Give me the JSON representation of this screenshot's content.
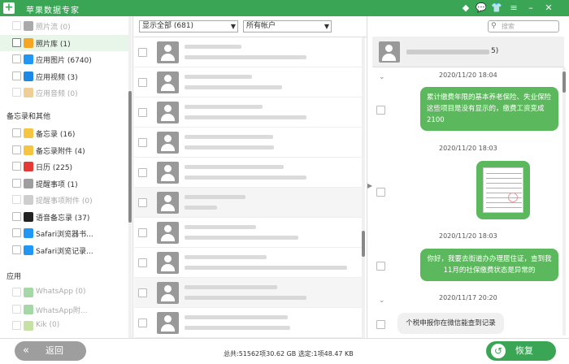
{
  "app": {
    "title": "苹果数据专家",
    "logo": "+"
  },
  "titlebar_icons": [
    "diamond-icon",
    "chat-icon",
    "skin-icon",
    "menu-icon",
    "minimize-icon",
    "close-icon"
  ],
  "sidebar": {
    "items_top": [
      {
        "label": "照片流 (0)",
        "icon": "camera-icon",
        "color": "#555",
        "disabled": true,
        "checked_style": "normal",
        "active": false
      },
      {
        "label": "照片库 (1)",
        "icon": "gallery-icon",
        "color": "#f5a623",
        "disabled": false,
        "checked_style": "green",
        "active": true
      },
      {
        "label": "应用图片 (6740)",
        "icon": "image-icon",
        "color": "#2196f3",
        "disabled": false,
        "checked_style": "normal",
        "active": false
      },
      {
        "label": "应用视频 (3)",
        "icon": "video-icon",
        "color": "#1e88e5",
        "disabled": false,
        "checked_style": "normal",
        "active": false
      },
      {
        "label": "应用音频 (0)",
        "icon": "audio-icon",
        "color": "#e0a030",
        "disabled": true,
        "checked_style": "normal",
        "active": false
      }
    ],
    "section_memo": "备忘录和其他",
    "items_memo": [
      {
        "label": "备忘录 (16)",
        "icon": "note-icon",
        "color": "#f5c542",
        "disabled": false
      },
      {
        "label": "备忘录附件 (4)",
        "icon": "note-attachment-icon",
        "color": "#f5c542",
        "disabled": false
      },
      {
        "label": "日历 (225)",
        "icon": "calendar-icon",
        "color": "#e53935",
        "disabled": false
      },
      {
        "label": "提醒事项 (1)",
        "icon": "reminder-icon",
        "color": "#9e9e9e",
        "disabled": false
      },
      {
        "label": "提醒事项附件 (0)",
        "icon": "reminder-attachment-icon",
        "color": "#9e9e9e",
        "disabled": true
      },
      {
        "label": "语音备忘录 (37)",
        "icon": "voice-memo-icon",
        "color": "#222",
        "disabled": false
      },
      {
        "label": "Safari浏览器书...",
        "icon": "safari-icon",
        "color": "#2196f3",
        "disabled": false
      },
      {
        "label": "Safari浏览记录...",
        "icon": "safari-history-icon",
        "color": "#2196f3",
        "disabled": false
      }
    ],
    "section_app": "应用",
    "items_app": [
      {
        "label": "WhatsApp (0)",
        "icon": "whatsapp-icon",
        "color": "#4caf50",
        "disabled": true
      },
      {
        "label": "WhatsApp附...",
        "icon": "whatsapp-attachment-icon",
        "color": "#4caf50",
        "disabled": true
      },
      {
        "label": "Kik (0)",
        "icon": "kik-icon",
        "color": "#8bc34a",
        "disabled": true
      }
    ]
  },
  "filters": {
    "show": "显示全部 (681)",
    "account": "所有帐户"
  },
  "search": {
    "placeholder": "搜索"
  },
  "conversation": {
    "title_suffix": "5)"
  },
  "messages": [
    {
      "time": "2020/11/20 18:04",
      "dir": "out",
      "text": "累计缴费年限的基本养老保险、失业保险这些项目是没有显示的，缴费工资变成2100"
    },
    {
      "time": "2020/11/20 18:03",
      "dir": "out-image",
      "text": ""
    },
    {
      "time": "2020/11/20 18:03",
      "dir": "out",
      "text": "你好，我要去街道办办理居住证，查到我11月的社保缴费状态是异常的"
    },
    {
      "time": "2020/11/17 20:20",
      "dir": "in",
      "text": "个税申报你在微信能查到记录"
    }
  ],
  "bottom": {
    "back_label": "返回",
    "summary": "总共:51562项30.62 GB 选定:1项48.47 KB",
    "restore_label": "恢复"
  }
}
